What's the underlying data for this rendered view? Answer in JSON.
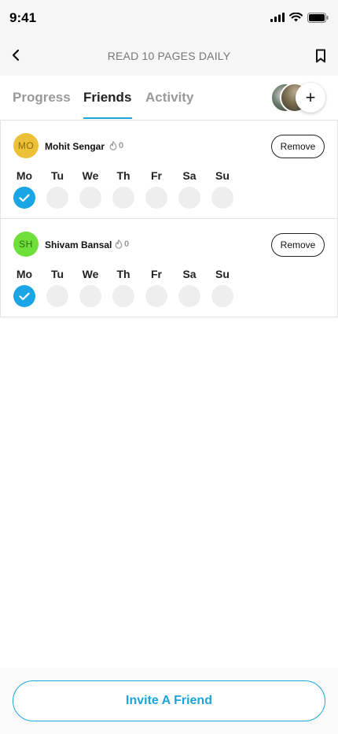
{
  "status_bar": {
    "time": "9:41"
  },
  "header": {
    "title": "READ 10 PAGES DAILY"
  },
  "tabs": [
    {
      "label": "Progress",
      "active": false
    },
    {
      "label": "Friends",
      "active": true
    },
    {
      "label": "Activity",
      "active": false
    }
  ],
  "add_friend_symbol": "+",
  "friends": [
    {
      "initials": "MO",
      "name": "Mohit Sengar",
      "streak": "0",
      "remove_label": "Remove",
      "avatar_color": "#ecc037",
      "avatar_text_color": "#8a6a10",
      "days": [
        {
          "label": "Mo",
          "done": true
        },
        {
          "label": "Tu",
          "done": false
        },
        {
          "label": "We",
          "done": false
        },
        {
          "label": "Th",
          "done": false
        },
        {
          "label": "Fr",
          "done": false
        },
        {
          "label": "Sa",
          "done": false
        },
        {
          "label": "Su",
          "done": false
        }
      ]
    },
    {
      "initials": "SH",
      "name": "Shivam Bansal",
      "streak": "0",
      "remove_label": "Remove",
      "avatar_color": "#6fe03a",
      "avatar_text_color": "#2e6a10",
      "days": [
        {
          "label": "Mo",
          "done": true
        },
        {
          "label": "Tu",
          "done": false
        },
        {
          "label": "We",
          "done": false
        },
        {
          "label": "Th",
          "done": false
        },
        {
          "label": "Fr",
          "done": false
        },
        {
          "label": "Sa",
          "done": false
        },
        {
          "label": "Su",
          "done": false
        }
      ]
    }
  ],
  "footer": {
    "invite_label": "Invite A Friend"
  },
  "colors": {
    "accent": "#1aa6dc",
    "check_fill": "#1aa6e4"
  }
}
